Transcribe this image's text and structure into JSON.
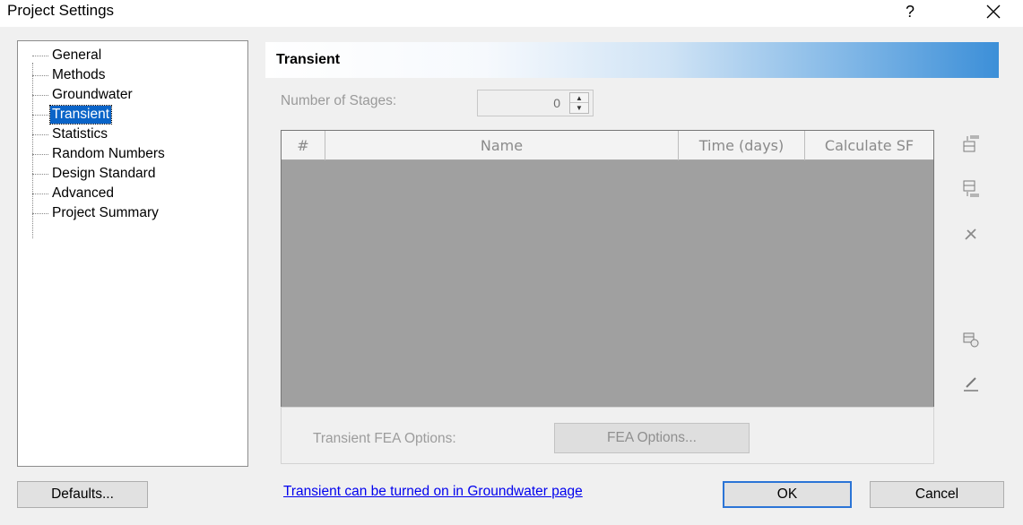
{
  "window": {
    "title": "Project Settings",
    "help_label": "?",
    "close_icon": "close-icon"
  },
  "tree": {
    "items": [
      {
        "label": "General",
        "selected": false
      },
      {
        "label": "Methods",
        "selected": false
      },
      {
        "label": "Groundwater",
        "selected": false
      },
      {
        "label": "Transient",
        "selected": true
      },
      {
        "label": "Statistics",
        "selected": false
      },
      {
        "label": "Random Numbers",
        "selected": false
      },
      {
        "label": "Design Standard",
        "selected": false
      },
      {
        "label": "Advanced",
        "selected": false
      },
      {
        "label": "Project Summary",
        "selected": false
      }
    ]
  },
  "panel": {
    "title": "Transient",
    "stages_label": "Number of Stages:",
    "stages_value": "0",
    "table": {
      "columns": [
        "#",
        "Name",
        "Time (days)",
        "Calculate SF"
      ],
      "rows": []
    },
    "side_tools": [
      "insert-row-above-icon",
      "insert-row-below-icon",
      "delete-row-icon",
      "copy-stage-icon",
      "edit-pencil-icon"
    ],
    "fea_label": "Transient FEA Options:",
    "fea_button": "FEA Options..."
  },
  "footer": {
    "defaults_button": "Defaults...",
    "link_text": "Transient can be turned on in Groundwater page",
    "ok_button": "OK",
    "cancel_button": "Cancel"
  },
  "colors": {
    "selection": "#0a64c8",
    "link": "#0000ee",
    "header_gradient_end": "#3c8fd8",
    "table_body": "#a0a0a0"
  }
}
